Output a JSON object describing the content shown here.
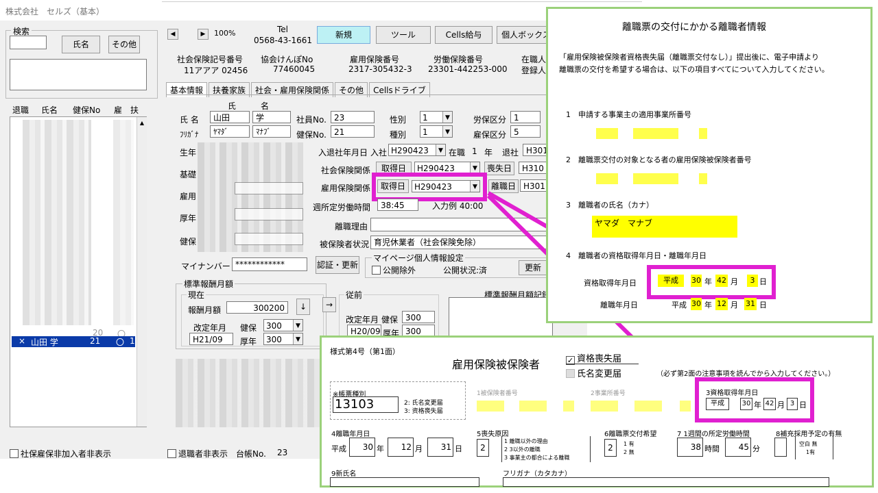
{
  "window": {
    "title": "株式会社　セルズ（基本）"
  },
  "left": {
    "search_label": "検索",
    "name_btn": "氏名",
    "other_btn": "その他",
    "col_headers": [
      "退職",
      "氏名",
      "健保No",
      "雇",
      "扶"
    ],
    "row_r": {
      "x": "×",
      "name": "山田 学",
      "no": "21",
      "koyo": "〇",
      "fu": "1"
    },
    "row_prev_no": "20",
    "row_prev_mark": "〇",
    "footer_check": "社保雇保非加入者非表示"
  },
  "toolbar": {
    "zoom": "100%",
    "tel_label": "Tel",
    "tel_value": "0568-43-1661",
    "new_btn": "新規",
    "tool_btn": "ツール",
    "cells_btn": "Cells給与",
    "personal_btn": "個人ボックス"
  },
  "headerinfo": {
    "shaho_label": "社会保険記号番号",
    "shaho_value": "11アアア 02456",
    "kyokai_label": "協会けんぽNo",
    "kyokai_value": "77460045",
    "koyo_label": "雇用保険番号",
    "koyo_value": "2317-305432-3",
    "rodo_label": "労働保険番号",
    "rodo_value": "23301-442253-000",
    "zaishoku_label": "在職人",
    "toroku_label": "登録人"
  },
  "tabs": [
    "基本情報",
    "扶養家族",
    "社会・雇用保険関係",
    "その他",
    "Cellsドライブ"
  ],
  "basic": {
    "name_label": "氏 名",
    "kana_label": "ﾌﾘｶﾞﾅ",
    "sei_label": "氏",
    "mei_label": "名",
    "sei": "山田",
    "mei": "学",
    "kana_sei": "ﾔﾏﾀﾞ",
    "kana_mei": "ﾏﾅﾌﾞ",
    "employee_no_label": "社員No.",
    "employee_no": "23",
    "kenpo_no_label": "健保No.",
    "kenpo_no": "21",
    "sex_label": "性別",
    "sex": "1",
    "type_label": "種別",
    "type": "1",
    "rouho_label": "労保区分",
    "rouho": "1",
    "koyo_kubun_label": "雇保区分",
    "koyo_kubun": "5",
    "birth_label": "生年",
    "kiso_label": "基礎",
    "koyo_row_label": "雇用",
    "kosei_label": "厚年",
    "kenshin_label": "健保",
    "nyutai_label": "入退社年月日",
    "nyusha_label": "入社",
    "nyusha": "H290423",
    "zaishoku_label": "在職",
    "zaishoku_years": "1",
    "nen_label": "年",
    "taisha_label": "退社",
    "taisha": "H301",
    "shaho_kankei_label": "社会保険関係",
    "shutoku_btn": "取得日",
    "shaho_shutoku": "H290423",
    "soshitsu_btn": "喪失日",
    "soshitsu": "H310",
    "koyo_kankei_label": "雇用保険関係",
    "koyo_shutoku": "H290423",
    "rishoku_btn": "離職日",
    "rishoku": "H301",
    "shotei_label": "週所定労働時間",
    "shotei": "38:45",
    "nyuryokurei": "入力例 40:00",
    "riyu_label": "離職理由",
    "hihoken_label": "被保険者状況",
    "hihoken": "育児休業者（社会保険免除）",
    "mynumber_label": "マイナンバー",
    "mynumber": "************",
    "auth_btn": "認証・更新",
    "mypage_label": "マイページ個人情報設定",
    "public_check": "公開除外",
    "public_status": "公開状況:済",
    "update_btn": "更新"
  },
  "hoshu": {
    "group_label": "標準報酬月額",
    "current_label": "現在",
    "monthly_label": "報酬月額",
    "monthly": "300200",
    "arrow_down": "↓",
    "arrow_right": "→",
    "kaitei_label": "改定年月",
    "kaitei": "H21/09",
    "kenpo_label": "健保",
    "kenpo": "300",
    "kounen_label": "厚年",
    "kounen": "300",
    "before_label": "従前",
    "before_kaitei": "H20/09",
    "before_kenpo": "300",
    "before_kounen": "300",
    "record_label": "標準報酬月額記録"
  },
  "footer": {
    "retire_check": "退職者非表示",
    "ledger_label": "台帳No.",
    "ledger_value": "23"
  },
  "panel_info": {
    "title": "離職票の交付にかかる離職者情報",
    "intro1": "「雇用保険被保険者資格喪失届（離職票交付なし）」提出後に、電子申請より",
    "intro2": "離職票の交付を希望する場合は、以下の項目すべてについて入力してください。",
    "item1": "1　申請する事業主の適用事業所番号",
    "item2": "2　離職票交付の対象となる者の雇用保険被保険者番号",
    "item3": "3　離職者の氏名（カナ）",
    "kana_name": "ヤマダ　マナブ",
    "item4": "4　離職者の資格取得年月日・離職年月日",
    "shutoku_label": "資格取得年月日",
    "rishoku_label": "離職年月日",
    "era": "平成",
    "shutoku_y": "30",
    "shutoku_m": "42",
    "shutoku_d": "3",
    "rishoku_y": "30",
    "rishoku_m": "12",
    "rishoku_d": "31",
    "y": "年",
    "m": "月",
    "d": "日"
  },
  "panel_form": {
    "form_no": "様式第4号（第1面）",
    "title": "雇用保険被保険者",
    "check1": "資格喪失届",
    "check2": "氏名変更届",
    "note": "（必ず第2面の注意事項を読んでから入力してください。）",
    "chohyo_label": "※帳票種別",
    "chohyo": "13103",
    "chohyo_opt1": "2: 氏名変更届",
    "chohyo_opt2": "3: 资格喪失届",
    "f1_label": "1被保険者番号",
    "f2_label": "2事業所番号",
    "f3_label": "3資格取得年月日",
    "era": "平成",
    "f3_y": "30",
    "f3_m": "42",
    "f3_d": "3",
    "f4_label": "4離職年月日",
    "f4_y": "30",
    "f4_m": "12",
    "f4_d": "31",
    "f5_label": "5喪失原因",
    "f5_value": "2",
    "f5_opt1": "1 離職以外の理由",
    "f5_opt2": "2 3以外の離職",
    "f5_opt3": "3 事業主の都合による離職",
    "f6_label": "6離職票交付希望",
    "f6_value": "2",
    "f6_opt1": "1 有",
    "f6_opt2": "2 無",
    "f7_label": "7 1週間の所定労働時間",
    "f7_h": "38",
    "f7_m": "45",
    "jikan": "時間",
    "fun": "分",
    "f8_label": "8補充採用予定の有無",
    "f8_opt1": "空白 無",
    "f8_opt2": "1有",
    "f9_label": "9新氏名",
    "f10_label": "フリガナ（カタカナ）",
    "y": "年",
    "m": "月",
    "d": "日"
  },
  "colors": {
    "highlight": "#e020d0",
    "panel_border": "#9bd17a",
    "field_yellow": "#ffff00",
    "new_button": "#bdf1f4"
  }
}
